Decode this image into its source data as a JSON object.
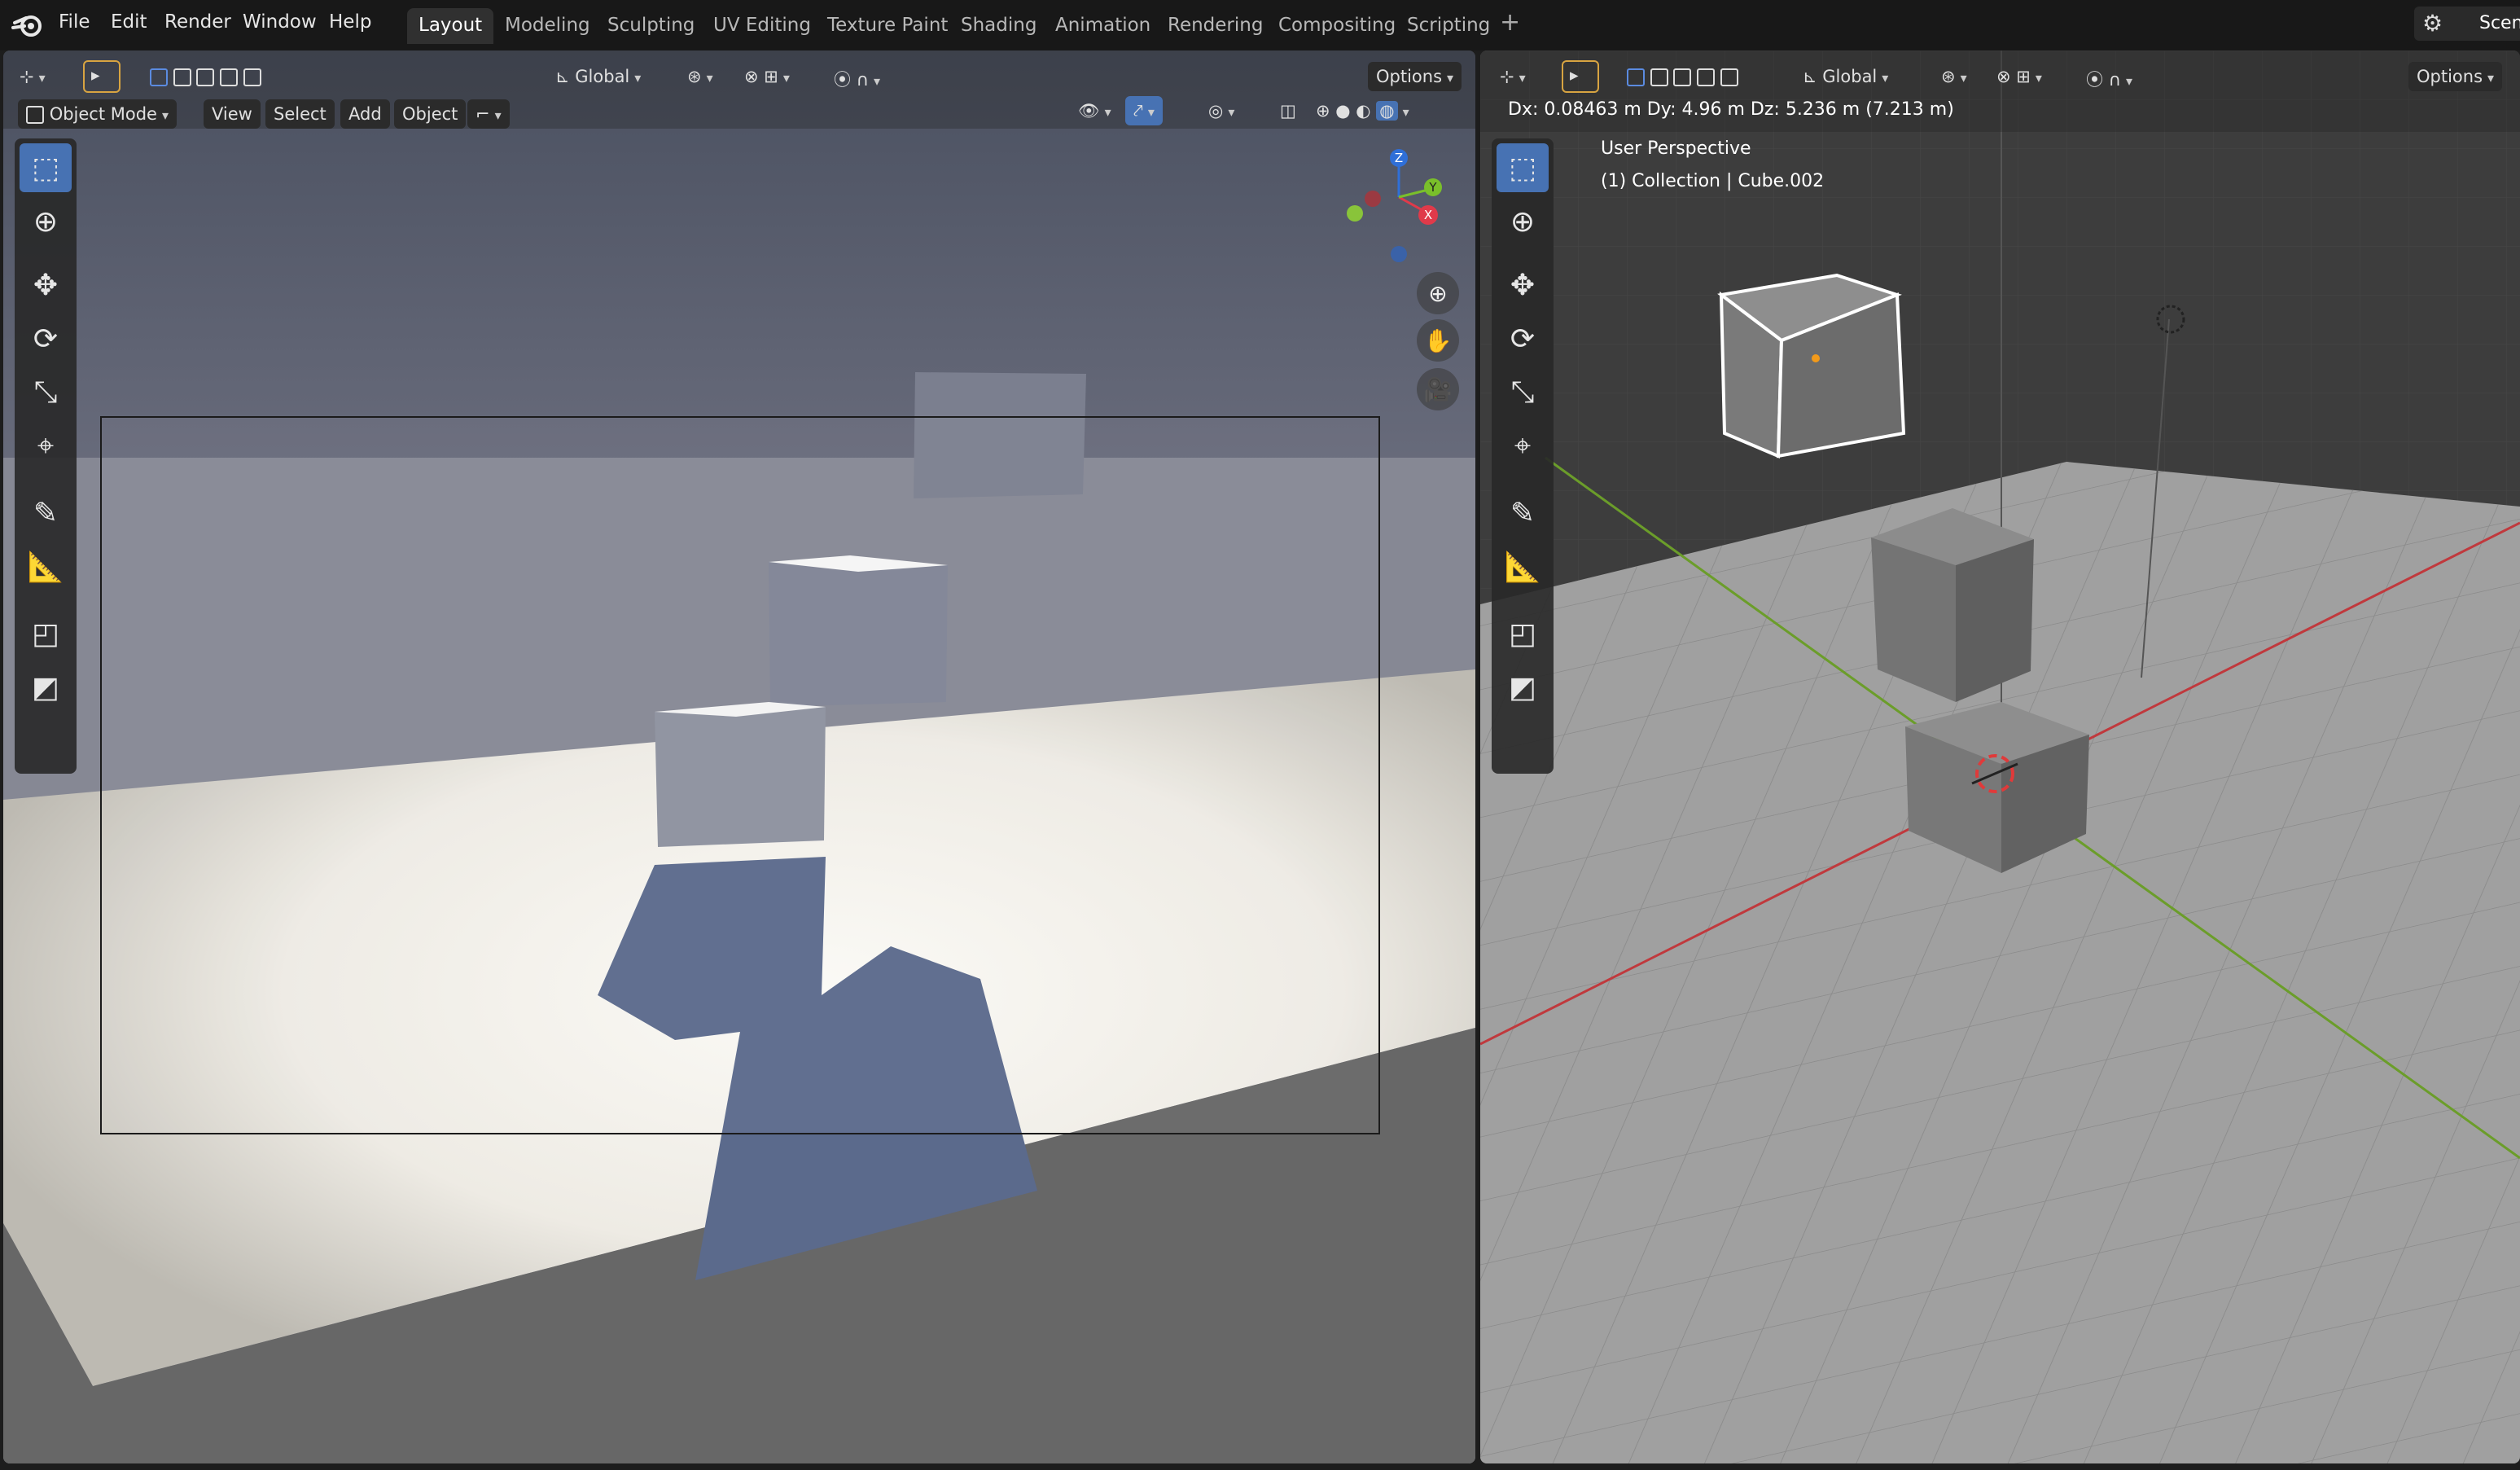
{
  "menubar": {
    "items": [
      "File",
      "Edit",
      "Render",
      "Window",
      "Help"
    ],
    "workspaces": [
      "Layout",
      "Modeling",
      "Sculpting",
      "UV Editing",
      "Texture Paint",
      "Shading",
      "Animation",
      "Rendering",
      "Compositing",
      "Scripting"
    ],
    "active_workspace": "Layout",
    "add_tab": "+",
    "scene_label": "Scene"
  },
  "left_viewport": {
    "transform_orientation": "Global",
    "options_label": "Options",
    "mode_label": "Object Mode",
    "menus": [
      "View",
      "Select",
      "Add",
      "Object"
    ],
    "gizmo_axes": {
      "x": "X",
      "y": "Y",
      "z": "Z"
    },
    "camera_view": true
  },
  "right_viewport": {
    "transform_orientation": "Global",
    "options_label": "Options",
    "status_text": "Dx: 0.08463 m   Dy: 4.96 m   Dz: 5.236 m (7.213 m)",
    "view_name": "User Perspective",
    "collection_label": "(1) Collection | Cube.002"
  },
  "colors": {
    "accent_active": "#4772b3",
    "sky_top": "#5d6373",
    "floor_lit": "#f3f1ec",
    "shadow": "#5b6a8c",
    "grid_floor": "#9a9a9a",
    "axis_x": "#c0393d",
    "axis_y": "#6b9d2a"
  },
  "icons": {
    "toolbar": [
      "select-box-icon",
      "cursor-icon",
      "move-icon",
      "rotate-icon",
      "scale-icon",
      "transform-icon",
      "annotate-icon",
      "measure-icon",
      "add-cube-icon",
      "add-primitive-icon"
    ]
  }
}
